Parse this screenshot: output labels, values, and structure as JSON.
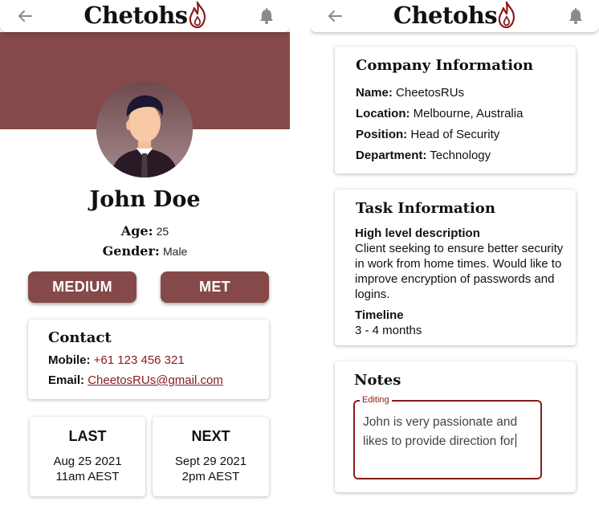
{
  "app": {
    "brand": "Chetohs",
    "brand_color": "#85494a",
    "accent_color": "#8b1a1a",
    "icons": {
      "back": "arrow-left-icon",
      "notifications": "bell-icon",
      "logo": "flame-icon"
    }
  },
  "profile": {
    "name": "John Doe",
    "age_label": "Age:",
    "age_value": "25",
    "gender_label": "Gender:",
    "gender_value": "Male",
    "avatar": "person-avatar"
  },
  "actions": {
    "priority_label": "MEDIUM",
    "status_label": "MET"
  },
  "contact": {
    "title": "Contact",
    "mobile_label": "Mobile:",
    "mobile_value": "+61 123 456 321",
    "email_label": "Email:",
    "email_value": "CheetosRUs@gmail.com"
  },
  "meetings": {
    "last": {
      "title": "LAST",
      "date": "Aug 25 2021",
      "time": "11am AEST"
    },
    "next": {
      "title": "NEXT",
      "date": "Sept 29 2021",
      "time": "2pm AEST"
    }
  },
  "company": {
    "title": "Company Information",
    "name_label": "Name:",
    "name_value": "CheetosRUs",
    "location_label": "Location:",
    "location_value": "Melbourne, Australia",
    "position_label": "Position:",
    "position_value": "Head of Security",
    "department_label": "Department:",
    "department_value": "Technology"
  },
  "task": {
    "title": "Task Information",
    "description_label": "High level description",
    "description_value": "Client seeking to ensure better security in work from home times. Would like to improve encryption of passwords and logins.",
    "timeline_label": "Timeline",
    "timeline_value": "3 - 4 months"
  },
  "notes": {
    "title": "Notes",
    "field_label": "Editing",
    "field_value": "John is very passionate and likes to provide direction for"
  }
}
